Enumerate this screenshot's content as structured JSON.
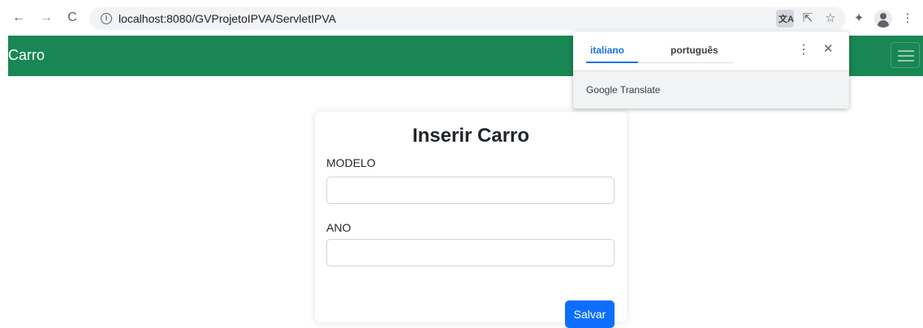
{
  "browser": {
    "url": "localhost:8080/GVProjetoIPVA/ServletIPVA",
    "back_icon": "←",
    "forward_icon": "→",
    "reload_icon": "C",
    "info_icon": "i",
    "translate_icon": "文A",
    "share_icon": "⇱",
    "star_icon": "☆",
    "extensions_icon": "✦",
    "menu_icon": "⋮"
  },
  "navbar": {
    "brand": "Carro",
    "color": "#198754"
  },
  "form": {
    "title": "Inserir Carro",
    "fields": [
      {
        "label": "MODELO",
        "value": ""
      },
      {
        "label": "ANO",
        "value": ""
      }
    ],
    "submit_label": "Salvar",
    "button_color": "#0d6efd"
  },
  "translate_popup": {
    "tabs": [
      {
        "label": "italiano",
        "active": true
      },
      {
        "label": "português",
        "active": false
      }
    ],
    "menu_icon": "⋮",
    "close_icon": "✕",
    "footer": "Google Translate"
  }
}
